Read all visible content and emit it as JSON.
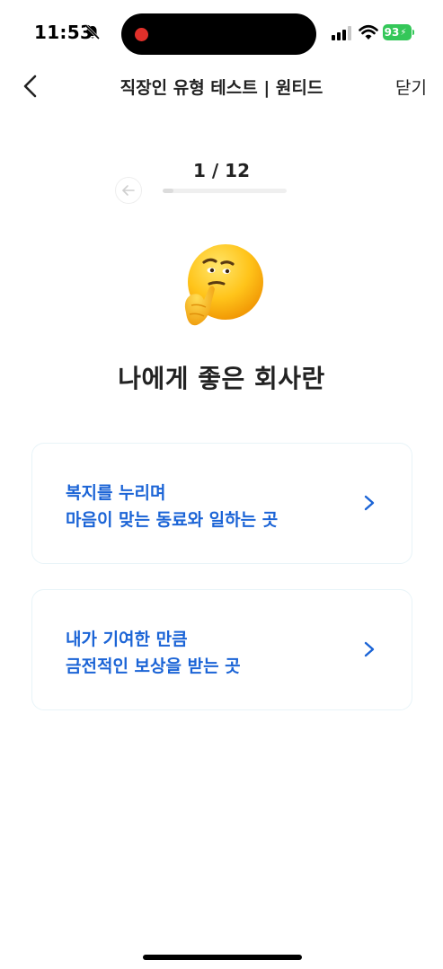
{
  "status_bar": {
    "time": "11:53",
    "battery": "93",
    "icons": [
      "bell-slash-icon",
      "signal-icon",
      "wifi-icon",
      "battery-icon"
    ]
  },
  "nav": {
    "back_icon": "chevron-left-icon",
    "title": "직장인 유형 테스트 | 원티드",
    "close_label": "닫기"
  },
  "progress": {
    "label": "1 / 12",
    "current": 1,
    "total": 12,
    "prev_icon": "arrow-left-icon"
  },
  "question": {
    "emoji": "thinking-face-icon",
    "text": "나에게 좋은 회사란"
  },
  "options": [
    {
      "line1": "복지를 누리며",
      "line2": "마음이 맞는 동료와 일하는 곳",
      "icon": "chevron-right-icon"
    },
    {
      "line1": "내가 기여한 만큼",
      "line2": "금전적인 보상을 받는 곳",
      "icon": "chevron-right-icon"
    }
  ],
  "colors": {
    "accent": "#1b64d6",
    "battery": "#34c759",
    "recording": "#e0302a",
    "card_border": "#e8f4f8"
  }
}
